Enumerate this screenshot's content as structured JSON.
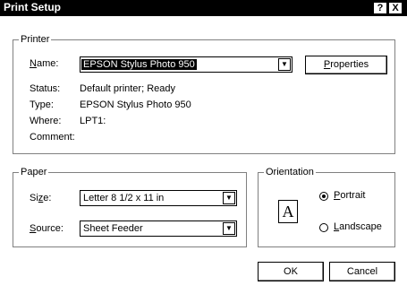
{
  "window": {
    "title": "Print Setup",
    "help_button": "?",
    "close_button": "X"
  },
  "printer": {
    "group_label": "Printer",
    "name_label": "Name:",
    "name_value": "EPSON Stylus Photo 950",
    "properties_button": "Properties",
    "status_label": "Status:",
    "status_value": "Default printer; Ready",
    "type_label": "Type:",
    "type_value": "EPSON Stylus Photo 950",
    "where_label": "Where:",
    "where_value": "LPT1:",
    "comment_label": "Comment:",
    "comment_value": ""
  },
  "paper": {
    "group_label": "Paper",
    "size_label": "Size:",
    "size_value": "Letter 8 1/2 x 11 in",
    "source_label": "Source:",
    "source_value": "Sheet Feeder"
  },
  "orientation": {
    "group_label": "Orientation",
    "icon_letter": "A",
    "portrait_label": "Portrait",
    "landscape_label": "Landscape",
    "selected": "Portrait"
  },
  "buttons": {
    "ok": "OK",
    "cancel": "Cancel"
  },
  "icons": {
    "dropdown": "chevron-down-icon",
    "orientation": "portrait-page-icon"
  }
}
